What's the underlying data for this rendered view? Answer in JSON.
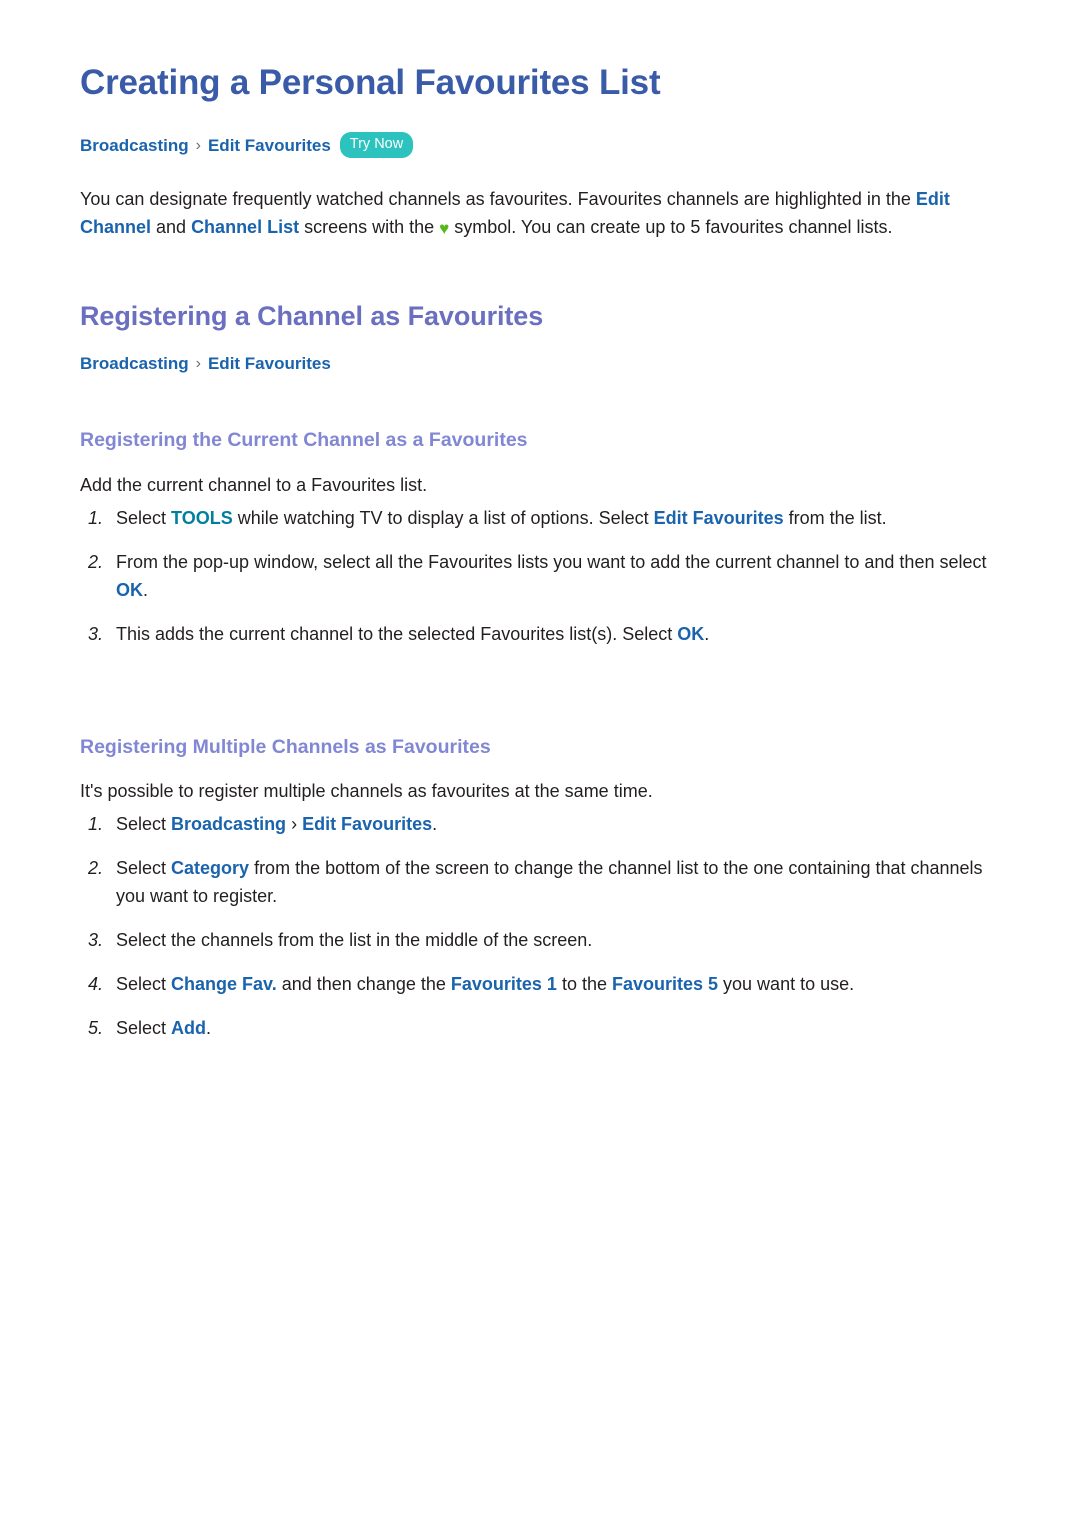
{
  "document": {
    "title": "Creating a Personal Favourites List",
    "colors": {
      "h1": "#3a5ba8",
      "h2": "#6b6fc0",
      "h3": "#8287d4",
      "link_blue": "#1a63ad",
      "keyword_teal": "#00809e",
      "badge_bg": "#2cc2bd",
      "heart_green": "#56b81a",
      "body_text": "#231f20",
      "separator": "#6d6e71",
      "background": "#ffffff"
    }
  },
  "breadcrumb_top": {
    "crumb1": "Broadcasting",
    "separator": "›",
    "crumb2": "Edit Favourites",
    "badge": "Try Now"
  },
  "intro": {
    "part1": "You can designate frequently watched channels as favourites. Favourites channels are highlighted in the ",
    "kw1": "Edit Channel",
    "part2": " and ",
    "kw2": "Channel List",
    "part3": " screens with the ",
    "heart_icon": "♥",
    "part4": " symbol. You can create up to 5 favourites channel lists."
  },
  "section": {
    "heading": "Registering a Channel as Favourites",
    "breadcrumb": {
      "crumb1": "Broadcasting",
      "separator": "›",
      "crumb2": "Edit Favourites"
    }
  },
  "subsection1": {
    "heading": "Registering the Current Channel as a Favourites",
    "intro": "Add the current channel to a Favourites list.",
    "steps": [
      {
        "num": "1.",
        "parts": [
          {
            "text": "Select ",
            "style": "plain"
          },
          {
            "text": "TOOLS",
            "style": "teal"
          },
          {
            "text": " while watching TV to display a list of options. Select ",
            "style": "plain"
          },
          {
            "text": "Edit Favourites",
            "style": "blue"
          },
          {
            "text": " from the list.",
            "style": "plain"
          }
        ]
      },
      {
        "num": "2.",
        "parts": [
          {
            "text": "From the pop-up window, select all the Favourites lists you want to add the current channel to and then select ",
            "style": "plain"
          },
          {
            "text": "OK",
            "style": "blue"
          },
          {
            "text": ".",
            "style": "plain"
          }
        ]
      },
      {
        "num": "3.",
        "parts": [
          {
            "text": "This adds the current channel to the selected Favourites list(s). Select ",
            "style": "plain"
          },
          {
            "text": "OK",
            "style": "blue"
          },
          {
            "text": ".",
            "style": "plain"
          }
        ]
      }
    ]
  },
  "subsection2": {
    "heading": "Registering Multiple Channels as Favourites",
    "intro": "It's possible to register multiple channels as favourites at the same time.",
    "steps": [
      {
        "num": "1.",
        "parts": [
          {
            "text": "Select ",
            "style": "plain"
          },
          {
            "text": "Broadcasting",
            "style": "blue"
          },
          {
            "text": " › ",
            "style": "sep"
          },
          {
            "text": "Edit Favourites",
            "style": "blue"
          },
          {
            "text": ".",
            "style": "plain"
          }
        ]
      },
      {
        "num": "2.",
        "parts": [
          {
            "text": "Select ",
            "style": "plain"
          },
          {
            "text": "Category",
            "style": "blue"
          },
          {
            "text": " from the bottom of the screen to change the channel list to the one containing that channels you want to register.",
            "style": "plain"
          }
        ]
      },
      {
        "num": "3.",
        "parts": [
          {
            "text": "Select the channels from the list in the middle of the screen.",
            "style": "plain"
          }
        ]
      },
      {
        "num": "4.",
        "parts": [
          {
            "text": "Select ",
            "style": "plain"
          },
          {
            "text": "Change Fav.",
            "style": "blue"
          },
          {
            "text": " and then change the ",
            "style": "plain"
          },
          {
            "text": "Favourites 1",
            "style": "blue"
          },
          {
            "text": " to the ",
            "style": "plain"
          },
          {
            "text": "Favourites 5",
            "style": "blue"
          },
          {
            "text": " you want to use.",
            "style": "plain"
          }
        ]
      },
      {
        "num": "5.",
        "parts": [
          {
            "text": "Select ",
            "style": "plain"
          },
          {
            "text": "Add",
            "style": "blue"
          },
          {
            "text": ".",
            "style": "plain"
          }
        ]
      }
    ]
  }
}
